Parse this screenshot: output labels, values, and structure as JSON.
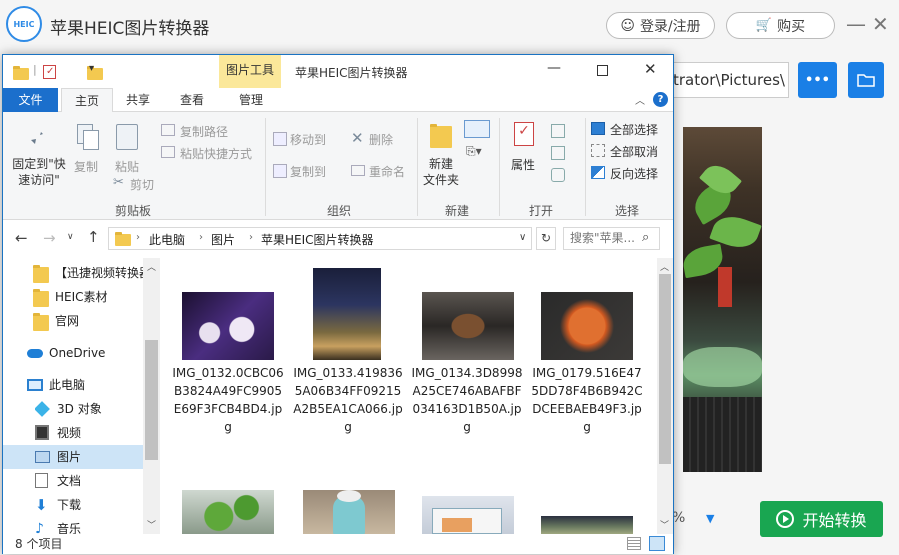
{
  "app": {
    "logo_text": "HEIC",
    "title": "苹果HEIC图片转换器",
    "login_label": "登录/注册",
    "buy_label": "购买",
    "path_value": "trator\\Pictures\\",
    "more_label": "•••",
    "start_label": "开始转换",
    "percent_fragment": "%"
  },
  "explorer": {
    "context_tab": "图片工具",
    "window_title": "苹果HEIC图片转换器",
    "tabs": [
      "文件",
      "主页",
      "共享",
      "查看",
      "管理"
    ],
    "ribbon": {
      "pin": "固定到\"快\n速访问\"",
      "copy": "复制",
      "paste": "粘贴",
      "copy_path": "复制路径",
      "paste_shortcut": "粘贴快捷方式",
      "cut": "剪切",
      "move_to": "移动到",
      "copy_to": "复制到",
      "delete": "删除",
      "rename": "重命名",
      "new_folder": "新建\n文件夹",
      "properties": "属性",
      "select_all": "全部选择",
      "select_none": "全部取消",
      "invert": "反向选择",
      "groups": [
        "剪贴板",
        "组织",
        "新建",
        "打开",
        "选择"
      ]
    },
    "breadcrumb": [
      "此电脑",
      "图片",
      "苹果HEIC图片转换器"
    ],
    "search_placeholder": "搜索\"苹果...",
    "nav": [
      {
        "label": "【迅捷视频转换器",
        "icon": "folder-icon"
      },
      {
        "label": "HEIC素材",
        "icon": "folder-icon"
      },
      {
        "label": "官网",
        "icon": "folder-icon"
      },
      {
        "label": "OneDrive",
        "icon": "cloud-icon"
      },
      {
        "label": "此电脑",
        "icon": "computer-icon"
      },
      {
        "label": "3D 对象",
        "icon": "cube-icon"
      },
      {
        "label": "视频",
        "icon": "video-icon"
      },
      {
        "label": "图片",
        "icon": "picture-icon"
      },
      {
        "label": "文档",
        "icon": "document-icon"
      },
      {
        "label": "下载",
        "icon": "download-icon"
      },
      {
        "label": "音乐",
        "icon": "music-icon"
      }
    ],
    "files": [
      "IMG_0132.0CBC06B3824A49FC9905E69F3FCB4BD4.jpg",
      "IMG_0133.4198365A06B34FF09215A2B5EA1CA066.jpg",
      "IMG_0134.3D8998A25CE746ABAFBF034163D1B50A.jpg",
      "IMG_0179.516E475DD78F4B6B942CDCEEBAEB49F3.jpg"
    ],
    "status": "8 个项目"
  }
}
